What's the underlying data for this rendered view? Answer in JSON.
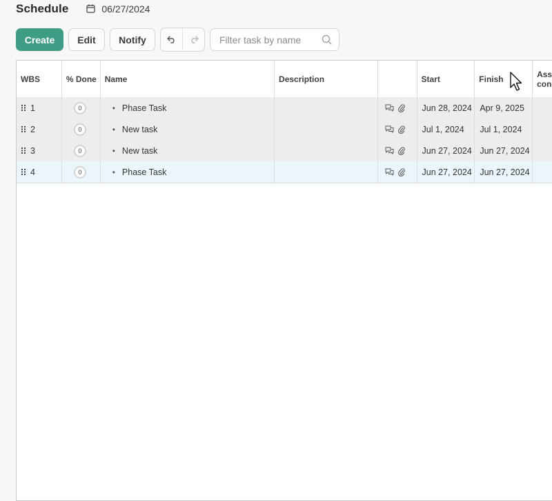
{
  "header": {
    "title": "Schedule",
    "date": "06/27/2024"
  },
  "toolbar": {
    "create_label": "Create",
    "edit_label": "Edit",
    "notify_label": "Notify",
    "search_placeholder": "Filter task by name"
  },
  "grid": {
    "columns": {
      "wbs": "WBS",
      "done": "% Done",
      "name": "Name",
      "description": "Description",
      "icons": "",
      "start": "Start",
      "finish": "Finish",
      "assigned": "Ass con"
    },
    "rows": [
      {
        "wbs": "1",
        "done": "0",
        "name": "Phase Task",
        "description": "",
        "start": "Jun 28, 2024",
        "finish": "Apr 9, 2025"
      },
      {
        "wbs": "2",
        "done": "0",
        "name": "New task",
        "description": "",
        "start": "Jul 1, 2024",
        "finish": "Jul 1, 2024"
      },
      {
        "wbs": "3",
        "done": "0",
        "name": "New task",
        "description": "",
        "start": "Jun 27, 2024",
        "finish": "Jun 27, 2024"
      },
      {
        "wbs": "4",
        "done": "0",
        "name": "Phase Task",
        "description": "",
        "start": "Jun 27, 2024",
        "finish": "Jun 27, 2024"
      }
    ],
    "selected_row": "4"
  },
  "colors": {
    "accent": "#3f9d85",
    "row_bg": "#ededee",
    "selected_row_bg": "#eaf6fb"
  },
  "icons": [
    "calendar-icon",
    "undo-icon",
    "redo-icon",
    "search-icon",
    "drag-handle-icon",
    "comment-icon",
    "attachment-icon",
    "mouse-cursor-icon"
  ]
}
